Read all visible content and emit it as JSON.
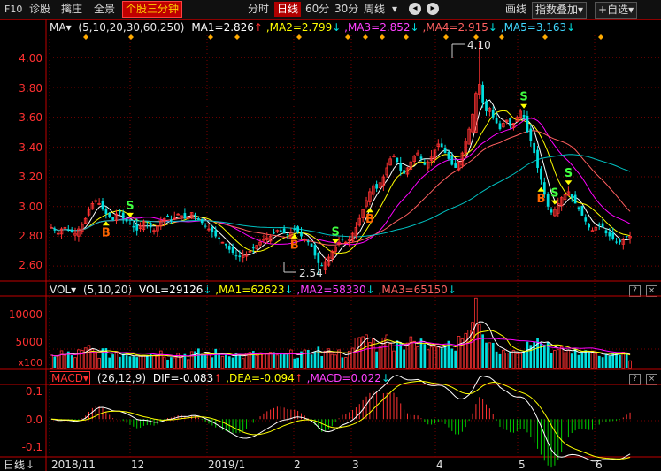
{
  "toolbar": {
    "items": [
      "F10",
      "诊股",
      "擒庄",
      "全景",
      "个股三分钟"
    ],
    "periods": [
      "分时",
      "日线",
      "60分",
      "30分",
      "周线"
    ],
    "right": [
      "画线",
      "指数叠加",
      "自选"
    ],
    "period_dropdown": "▾",
    "nav_prev": "◂",
    "nav_next": "▸",
    "right_dropdown": "▾",
    "add_prefix": "+"
  },
  "main_legend": {
    "name": "MA",
    "params": "(5,10,20,30,60,250)",
    "ma1": "MA1=2.826",
    "ma2": ",MA2=2.799",
    "ma3": ",MA3=2.852",
    "ma4": ",MA4=2.915",
    "ma5": ",MA5=3.163",
    "arrows": [
      "↑",
      "↓",
      "↓",
      "↓",
      "↓"
    ]
  },
  "price_axis": [
    "4.00",
    "3.80",
    "3.60",
    "3.40",
    "3.20",
    "3.00",
    "2.80",
    "2.60"
  ],
  "annotations": {
    "high": "4.10",
    "low": "2.54"
  },
  "signals": {
    "buy": "B",
    "sell": "S"
  },
  "vol_legend": {
    "name": "VOL",
    "params": "(5,10,20)",
    "vol": "VOL=29126",
    "ma1": ",MA1=62623",
    "ma2": ",MA2=58330",
    "ma3": ",MA3=65150",
    "arrows": [
      "↓",
      "↓",
      "↓",
      "↓"
    ]
  },
  "vol_axis": [
    "10000",
    "5000",
    "x100"
  ],
  "macd_legend": {
    "name": "MACD",
    "params": "(26,12,9)",
    "dif": "DIF=-0.083",
    "dea": ",DEA=-0.094",
    "macd": ",MACD=0.022",
    "arrows": [
      "↑",
      "↑",
      "↓"
    ]
  },
  "macd_axis": [
    "0.1",
    "0.0",
    "-0.1"
  ],
  "panel_buttons": [
    "?",
    "×"
  ],
  "bottom": {
    "period": "日线",
    "period_arrow": "↓",
    "dates": [
      "2018/11",
      "12",
      "2019/1",
      "2",
      "3",
      "4",
      "5",
      "6"
    ]
  },
  "colors": {
    "up": "#ff3232",
    "down": "#00e0e0",
    "ma1": "#ffffff",
    "ma2": "#ffff00",
    "ma3": "#ff00ff",
    "ma4": "#ff6060",
    "ma5": "#00c0c0",
    "axis": "#c00000",
    "price_text": "#ff3030",
    "signal_b": "#ff6600",
    "signal_s": "#40ff40"
  },
  "chart_data": {
    "type": "candlestick",
    "period": "daily",
    "x_range": [
      "2018/11",
      "2019/6"
    ],
    "ylim": [
      2.5,
      4.15
    ],
    "high": 4.1,
    "low": 2.54,
    "closes": [
      2.86,
      2.84,
      2.82,
      2.85,
      2.86,
      2.84,
      2.83,
      2.82,
      2.85,
      2.88,
      2.92,
      2.98,
      3.02,
      3.04,
      3.02,
      2.98,
      2.95,
      2.93,
      2.91,
      2.95,
      2.96,
      2.92,
      2.9,
      2.88,
      2.86,
      2.84,
      2.87,
      2.9,
      2.88,
      2.86,
      2.84,
      2.87,
      2.9,
      2.92,
      2.93,
      2.91,
      2.93,
      2.95,
      2.94,
      2.92,
      2.93,
      2.96,
      2.94,
      2.91,
      2.89,
      2.87,
      2.85,
      2.83,
      2.8,
      2.78,
      2.76,
      2.74,
      2.71,
      2.69,
      2.67,
      2.66,
      2.67,
      2.68,
      2.7,
      2.72,
      2.74,
      2.76,
      2.78,
      2.79,
      2.8,
      2.82,
      2.84,
      2.83,
      2.82,
      2.81,
      2.83,
      2.85,
      2.83,
      2.8,
      2.78,
      2.76,
      2.73,
      2.67,
      2.62,
      2.6,
      2.63,
      2.66,
      2.7,
      2.73,
      2.76,
      2.78,
      2.76,
      2.78,
      2.82,
      2.86,
      2.92,
      2.98,
      3.04,
      3.1,
      3.14,
      3.12,
      3.16,
      3.2,
      3.26,
      3.32,
      3.34,
      3.3,
      3.24,
      3.22,
      3.26,
      3.3,
      3.34,
      3.36,
      3.32,
      3.28,
      3.3,
      3.34,
      3.38,
      3.42,
      3.4,
      3.36,
      3.32,
      3.28,
      3.26,
      3.3,
      3.36,
      3.44,
      3.52,
      3.62,
      3.76,
      3.82,
      3.7,
      3.64,
      3.66,
      3.6,
      3.56,
      3.52,
      3.56,
      3.58,
      3.54,
      3.56,
      3.6,
      3.64,
      3.6,
      3.5,
      3.44,
      3.36,
      3.26,
      3.18,
      3.08,
      3.0,
      2.96,
      2.98,
      3.02,
      3.06,
      3.08,
      3.1,
      3.06,
      3.02,
      2.98,
      2.94,
      2.9,
      2.86,
      2.84,
      2.86,
      2.88,
      2.86,
      2.82,
      2.8,
      2.78,
      2.76,
      2.76,
      2.78,
      2.8,
      2.8
    ],
    "buy_signals_at": [
      16,
      71,
      93,
      143
    ],
    "sell_signals_at": [
      23,
      83,
      138,
      147,
      151
    ],
    "volume": {
      "ylim": [
        0,
        13000
      ]
    },
    "macd": {
      "ylim": [
        -0.12,
        0.11
      ],
      "dif": -0.083,
      "dea": -0.094,
      "macd": 0.022
    }
  }
}
